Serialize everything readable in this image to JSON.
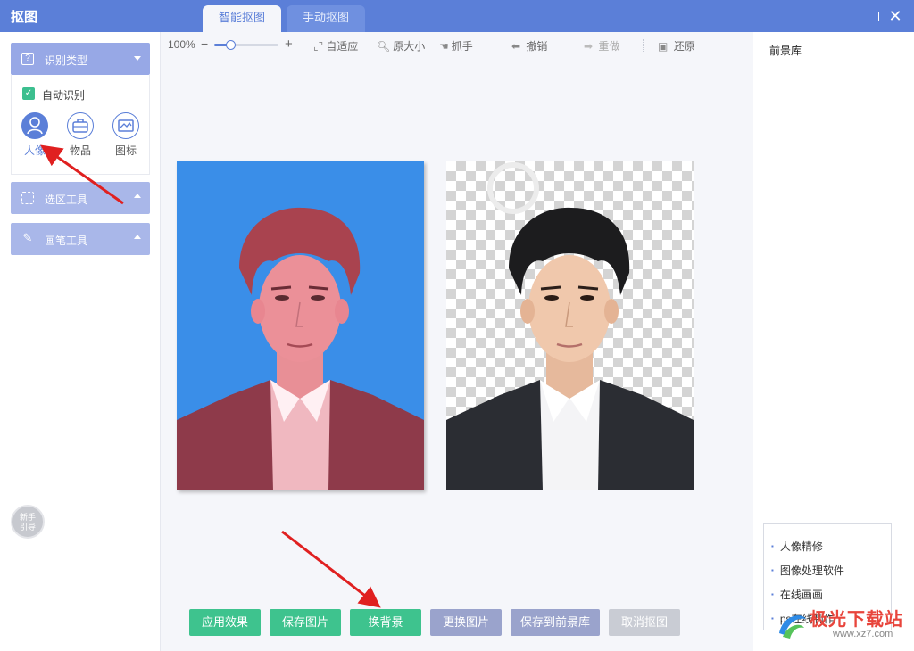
{
  "app": {
    "title": "抠图",
    "tabs": [
      {
        "label": "智能抠图",
        "active": true
      },
      {
        "label": "手动抠图",
        "active": false
      }
    ]
  },
  "sidebar": {
    "recognize": {
      "label": "识别类型"
    },
    "auto_recognize": {
      "label": "自动识别",
      "checked": true
    },
    "types": [
      {
        "label": "人像",
        "icon": "person-icon",
        "selected": true
      },
      {
        "label": "物品",
        "icon": "bag-icon",
        "selected": false
      },
      {
        "label": "图标",
        "icon": "picture-icon",
        "selected": false
      }
    ],
    "select_tool": {
      "label": "选区工具"
    },
    "brush_tool": {
      "label": "画笔工具"
    },
    "guide": {
      "line1": "新手",
      "line2": "引导"
    }
  },
  "toolbar": {
    "zoom": "100%",
    "zoom_level": 0.25,
    "fit": "自适应",
    "original_size": "原大小",
    "grab": "抓手",
    "undo": "撤销",
    "redo": "重做",
    "restore": "还原"
  },
  "actions": {
    "apply": "应用效果",
    "save_image": "保存图片",
    "change_bg": "换背景",
    "replace_image": "更换图片",
    "save_to_library": "保存到前景库",
    "cancel": "取消抠图"
  },
  "right_panel": {
    "title": "前景库",
    "links": [
      "人像精修",
      "图像处理软件",
      "在线画画",
      "ps在线制作"
    ]
  },
  "watermark": {
    "name": "极光下载站",
    "url": "www.xz7.com"
  },
  "colors": {
    "accent": "#5b7fd8",
    "green": "#3ec38e",
    "photo_bg": "#3a8ee8",
    "annotation_red": "#e02020"
  }
}
